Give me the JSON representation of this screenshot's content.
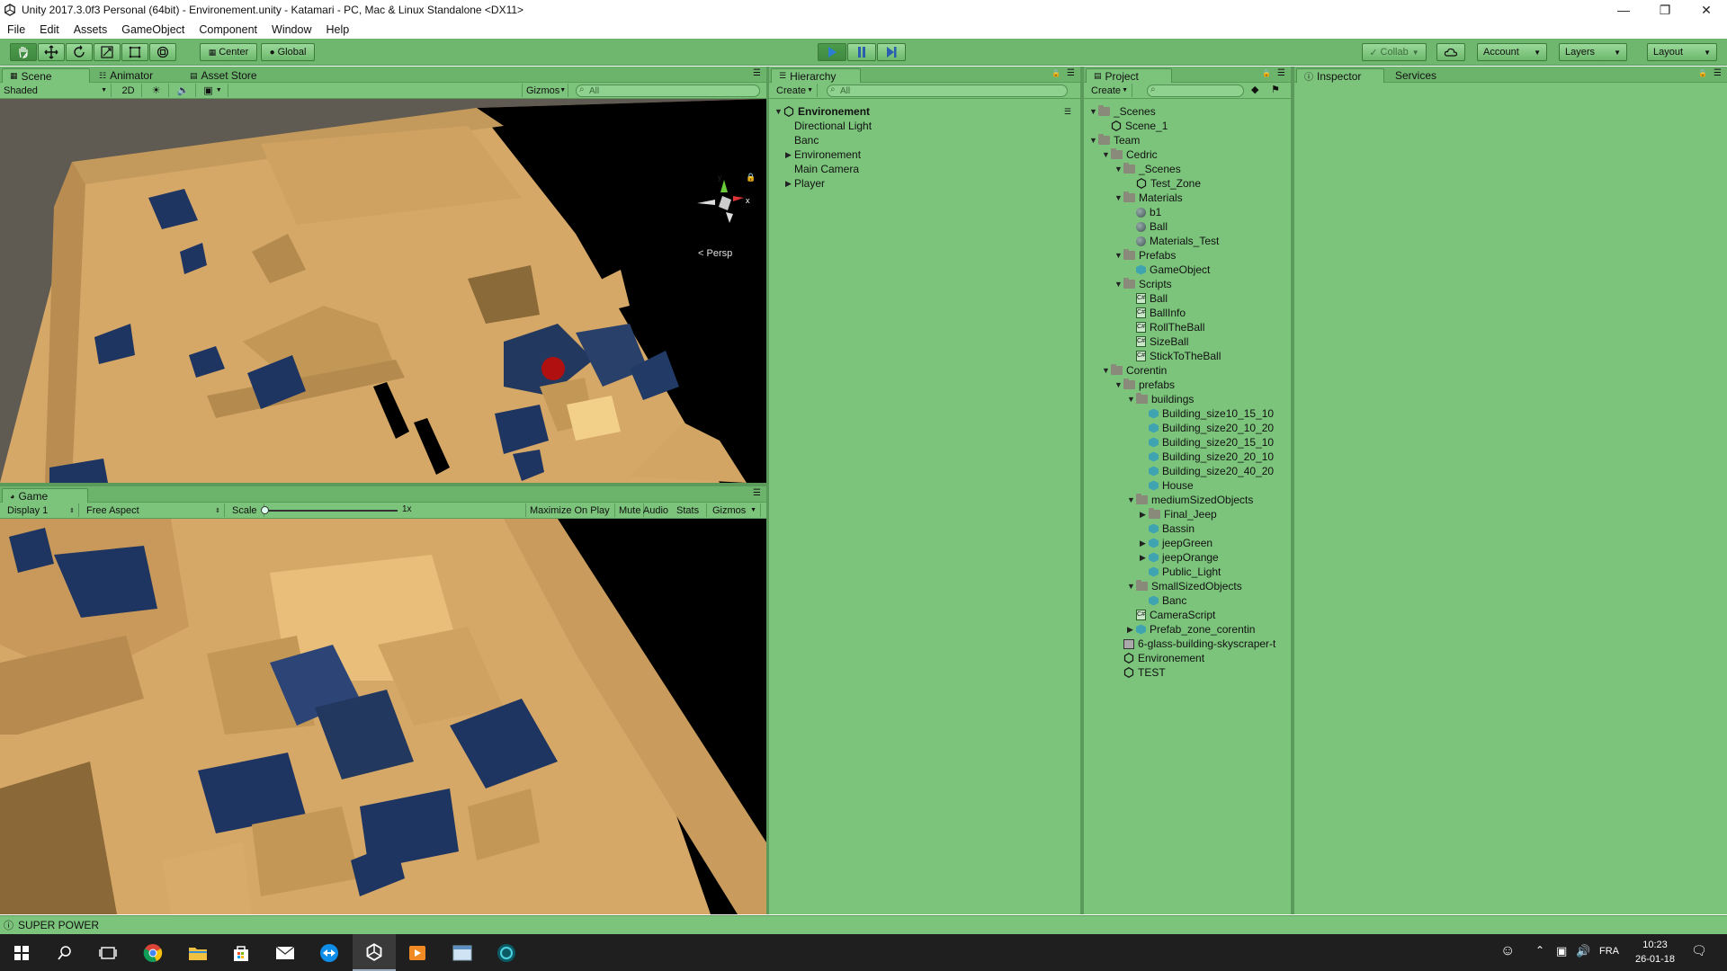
{
  "window": {
    "title": "Unity 2017.3.0f3 Personal (64bit) - Environement.unity - Katamari - PC, Mac & Linux Standalone <DX11>"
  },
  "menu": [
    "File",
    "Edit",
    "Assets",
    "GameObject",
    "Component",
    "Window",
    "Help"
  ],
  "toolbar": {
    "center_label": "Center",
    "global_label": "Global",
    "collab_label": "Collab",
    "account_label": "Account",
    "layers_label": "Layers",
    "layout_label": "Layout"
  },
  "scene": {
    "tabs": [
      "Scene",
      "Animator",
      "Asset Store"
    ],
    "shading": "Shaded",
    "mode_2d": "2D",
    "gizmos": "Gizmos",
    "search_placeholder": "All",
    "persp_label": "Persp",
    "gizmo_axes": [
      "y",
      "x"
    ]
  },
  "game": {
    "tab": "Game",
    "display": "Display 1",
    "aspect": "Free Aspect",
    "scale_label": "Scale",
    "scale_value": "1x",
    "maximize": "Maximize On Play",
    "mute": "Mute Audio",
    "stats": "Stats",
    "gizmos": "Gizmos"
  },
  "hierarchy": {
    "tab": "Hierarchy",
    "create": "Create",
    "search_placeholder": "All",
    "scene_name": "Environement",
    "items": [
      {
        "label": "Directional Light",
        "has_children": false
      },
      {
        "label": "Banc",
        "has_children": false
      },
      {
        "label": "Environement",
        "has_children": true
      },
      {
        "label": "Main Camera",
        "has_children": false
      },
      {
        "label": "Player",
        "has_children": true
      }
    ]
  },
  "project": {
    "tab": "Project",
    "create": "Create",
    "items": [
      {
        "label": "_Scenes",
        "depth": 0,
        "icon": "folder",
        "arrow": "down"
      },
      {
        "label": "Scene_1",
        "depth": 1,
        "icon": "unity",
        "arrow": ""
      },
      {
        "label": "Team",
        "depth": 0,
        "icon": "folder",
        "arrow": "down"
      },
      {
        "label": "Cedric",
        "depth": 1,
        "icon": "folder",
        "arrow": "down"
      },
      {
        "label": "_Scenes",
        "depth": 2,
        "icon": "folder",
        "arrow": "down"
      },
      {
        "label": "Test_Zone",
        "depth": 3,
        "icon": "unity",
        "arrow": ""
      },
      {
        "label": "Materials",
        "depth": 2,
        "icon": "folder",
        "arrow": "down"
      },
      {
        "label": "b1",
        "depth": 3,
        "icon": "sphere",
        "arrow": ""
      },
      {
        "label": "Ball",
        "depth": 3,
        "icon": "sphere",
        "arrow": ""
      },
      {
        "label": "Materials_Test",
        "depth": 3,
        "icon": "sphere",
        "arrow": ""
      },
      {
        "label": "Prefabs",
        "depth": 2,
        "icon": "folder",
        "arrow": "down"
      },
      {
        "label": "GameObject",
        "depth": 3,
        "icon": "cube",
        "arrow": ""
      },
      {
        "label": "Scripts",
        "depth": 2,
        "icon": "folder",
        "arrow": "down"
      },
      {
        "label": "Ball",
        "depth": 3,
        "icon": "script",
        "arrow": ""
      },
      {
        "label": "BallInfo",
        "depth": 3,
        "icon": "script",
        "arrow": ""
      },
      {
        "label": "RollTheBall",
        "depth": 3,
        "icon": "script",
        "arrow": ""
      },
      {
        "label": "SizeBall",
        "depth": 3,
        "icon": "script",
        "arrow": ""
      },
      {
        "label": "StickToTheBall",
        "depth": 3,
        "icon": "script",
        "arrow": ""
      },
      {
        "label": "Corentin",
        "depth": 1,
        "icon": "folder",
        "arrow": "down"
      },
      {
        "label": "prefabs",
        "depth": 2,
        "icon": "folder",
        "arrow": "down"
      },
      {
        "label": "buildings",
        "depth": 3,
        "icon": "folder",
        "arrow": "down"
      },
      {
        "label": "Building_size10_15_10",
        "depth": 4,
        "icon": "cube",
        "arrow": ""
      },
      {
        "label": "Building_size20_10_20",
        "depth": 4,
        "icon": "cube",
        "arrow": ""
      },
      {
        "label": "Building_size20_15_10",
        "depth": 4,
        "icon": "cube",
        "arrow": ""
      },
      {
        "label": "Building_size20_20_10",
        "depth": 4,
        "icon": "cube",
        "arrow": ""
      },
      {
        "label": "Building_size20_40_20",
        "depth": 4,
        "icon": "cube",
        "arrow": ""
      },
      {
        "label": "House",
        "depth": 4,
        "icon": "cube",
        "arrow": ""
      },
      {
        "label": "mediumSizedObjects",
        "depth": 3,
        "icon": "folder",
        "arrow": "down"
      },
      {
        "label": "Final_Jeep",
        "depth": 4,
        "icon": "folder",
        "arrow": "right"
      },
      {
        "label": "Bassin",
        "depth": 4,
        "icon": "cube",
        "arrow": ""
      },
      {
        "label": "jeepGreen",
        "depth": 4,
        "icon": "cube",
        "arrow": "right"
      },
      {
        "label": "jeepOrange",
        "depth": 4,
        "icon": "cube",
        "arrow": "right"
      },
      {
        "label": "Public_Light",
        "depth": 4,
        "icon": "cube",
        "arrow": ""
      },
      {
        "label": "SmallSizedObjects",
        "depth": 3,
        "icon": "folder",
        "arrow": "down"
      },
      {
        "label": "Banc",
        "depth": 4,
        "icon": "cube",
        "arrow": ""
      },
      {
        "label": "CameraScript",
        "depth": 3,
        "icon": "script",
        "arrow": ""
      },
      {
        "label": "Prefab_zone_corentin",
        "depth": 3,
        "icon": "cube",
        "arrow": "right"
      },
      {
        "label": "6-glass-building-skyscraper-t",
        "depth": 2,
        "icon": "image",
        "arrow": ""
      },
      {
        "label": "Environement",
        "depth": 2,
        "icon": "unity",
        "arrow": ""
      },
      {
        "label": "TEST",
        "depth": 2,
        "icon": "unity",
        "arrow": ""
      }
    ]
  },
  "inspector": {
    "tabs": [
      "Inspector",
      "Services"
    ]
  },
  "status": {
    "message": "SUPER POWER"
  },
  "taskbar": {
    "language": "FRA",
    "time": "10:23",
    "date": "26-01-18"
  }
}
